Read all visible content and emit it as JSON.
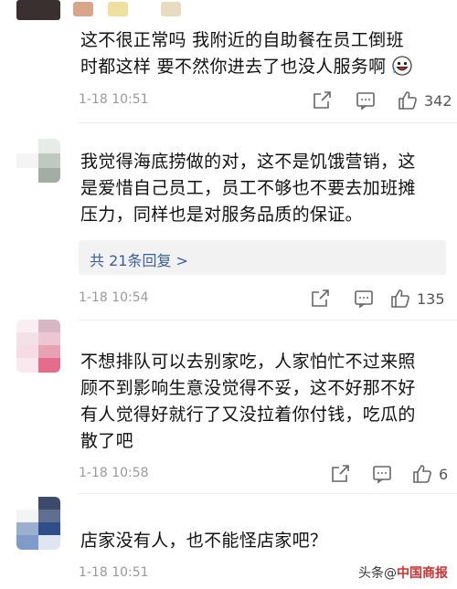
{
  "comments": [
    {
      "text_lines": [
        "这不很正常吗  我附近的自助餐在员工倒班",
        "时都这样  要不然你进去了也没人服务啊"
      ],
      "time": "1-18 10:51",
      "likes": "342"
    },
    {
      "text_lines": [
        "我觉得海底捞做的对，这不是饥饿营销，这",
        "是爱惜自己员工，员工不够也不要去加班摊",
        "压力，同样也是对服务品质的保证。"
      ],
      "reply_label": "共 21条回复 >",
      "time": "1-18 10:54",
      "likes": "135"
    },
    {
      "text_lines": [
        "不想排队可以去别家吃，人家怕忙不过来照",
        "顾不到影响生意没觉得不妥，这不好那不好",
        "有人觉得好就行了又没拉着你付钱，吃瓜的",
        "散了吧"
      ],
      "time": "1-18 10:58",
      "likes": "6"
    },
    {
      "text_lines": [
        "店家没有人，也不能怪店家吧？"
      ],
      "time": "1-18 10:51",
      "likes": ""
    }
  ],
  "watermark": {
    "prefix": "头条",
    "at": "@",
    "name": "中国商报"
  },
  "icons": {
    "share": "share-icon",
    "comment": "comment-icon",
    "like": "thumbs-up-icon",
    "emoji": "grinning-emoji-icon"
  },
  "colors": {
    "reply_link": "#3a5f9a",
    "time": "#9a9a9a",
    "reply_bg": "#f2f2f2"
  }
}
